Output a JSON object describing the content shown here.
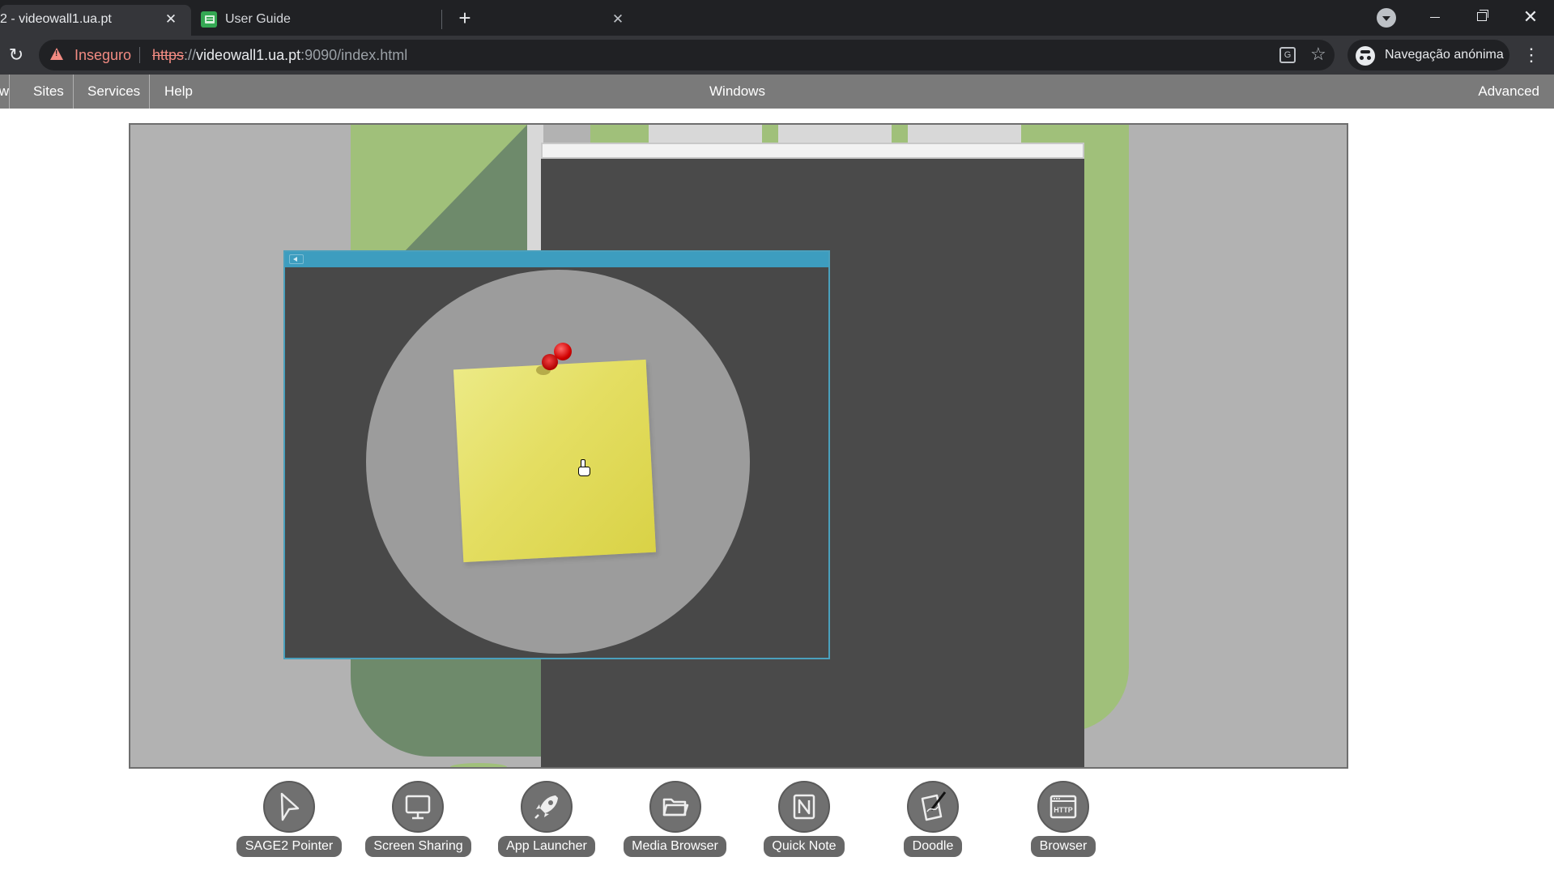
{
  "browser": {
    "tabs": [
      {
        "title": "2 - videowall1.ua.pt",
        "active": true
      },
      {
        "title": "User Guide",
        "active": false
      }
    ],
    "new_tab_label": "+",
    "close_glyph": "✕",
    "address": {
      "security_label": "Inseguro",
      "url_scheme": "https",
      "url_sep": "://",
      "url_host": "videowall1.ua.pt",
      "url_rest": ":9090/index.html"
    },
    "profile_label": "Navegação anónima"
  },
  "menu": {
    "items": [
      {
        "label": "ew"
      },
      {
        "label": "Sites"
      },
      {
        "label": "Services"
      },
      {
        "label": "Help"
      }
    ],
    "center_label": "Windows",
    "right_label": "Advanced"
  },
  "toolbar": {
    "tools": [
      {
        "label": "SAGE2 Pointer",
        "icon": "pointer-icon"
      },
      {
        "label": "Screen Sharing",
        "icon": "monitor-icon"
      },
      {
        "label": "App Launcher",
        "icon": "rocket-icon"
      },
      {
        "label": "Media Browser",
        "icon": "folder-icon"
      },
      {
        "label": "Quick Note",
        "icon": "note-icon"
      },
      {
        "label": "Doodle",
        "icon": "pencil-icon"
      },
      {
        "label": "Browser",
        "icon": "browser-icon",
        "badge": "HTTP"
      }
    ]
  },
  "colors": {
    "tab_bar": "#202124",
    "menu_bar": "#7a7a7a",
    "canvas": "#b2b2b2",
    "accent_blue": "#3d9dbf",
    "green": "#a0c07a",
    "sticky_yellow": "#e4de62",
    "pin_red": "#d00000"
  }
}
